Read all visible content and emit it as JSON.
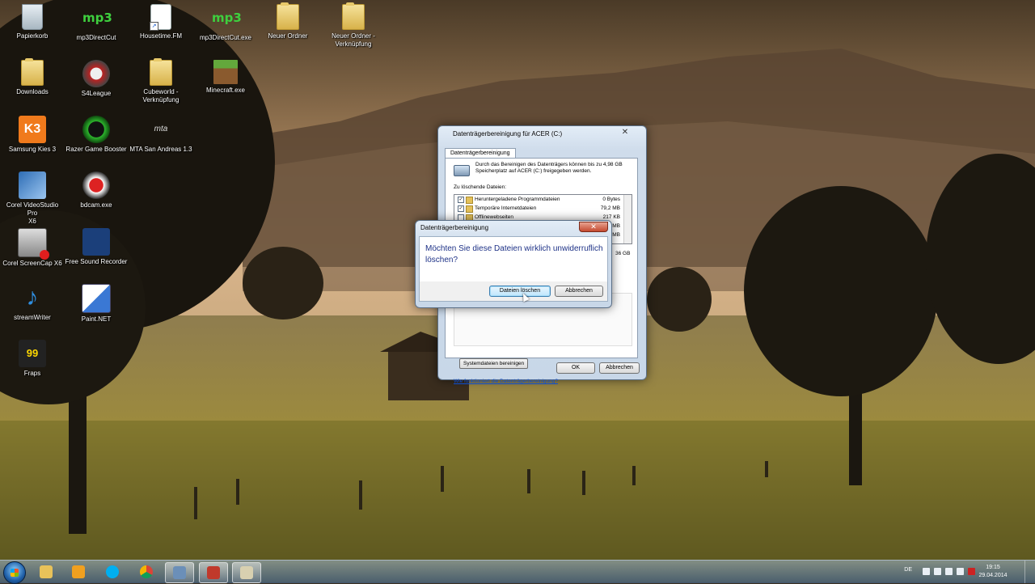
{
  "desktop": {
    "icons": [
      {
        "label": "Papierkorb",
        "icon": "recycle-bin-icon"
      },
      {
        "label": "mp3DirectCut",
        "icon": "mp3-icon",
        "glyph": "mp3"
      },
      {
        "label": "Housetime.FM",
        "icon": "document-icon"
      },
      {
        "label": "mp3DirectCut.exe",
        "icon": "mp3-icon",
        "glyph": "mp3"
      },
      {
        "label": "Neuer Ordner",
        "icon": "folder-icon"
      },
      {
        "label": "Neuer Ordner -",
        "label2": "Verknüpfung",
        "icon": "folder-icon"
      },
      {
        "label": "Downloads",
        "icon": "folder-icon"
      },
      {
        "label": "S4League",
        "icon": "s4league-icon"
      },
      {
        "label": "Cubeworld -",
        "label2": "Verknüpfung",
        "icon": "folder-icon"
      },
      {
        "label": "Minecraft.exe",
        "icon": "minecraft-icon"
      },
      {
        "label": "Samsung Kies 3",
        "icon": "kies-icon",
        "glyph": "K3"
      },
      {
        "label": "Razer Game Booster",
        "icon": "razer-icon"
      },
      {
        "label": "MTA San Andreas 1.3",
        "icon": "mta-icon",
        "glyph": "mta"
      },
      {
        "label": "Corel VideoStudio Pro",
        "label2": "X6",
        "icon": "corel-icon"
      },
      {
        "label": "bdcam.exe",
        "icon": "bandicam-icon"
      },
      {
        "label": "Corel ScreenCap X6",
        "icon": "screencap-icon"
      },
      {
        "label": "Free Sound Recorder",
        "icon": "sound-recorder-icon"
      },
      {
        "label": "streamWriter",
        "icon": "music-note-icon",
        "glyph": "♪"
      },
      {
        "label": "Paint.NET",
        "icon": "paint-icon"
      },
      {
        "label": "Fraps",
        "icon": "fraps-icon",
        "glyph": "99"
      }
    ]
  },
  "cleanup_window": {
    "title": "Datenträgerbereinigung für ACER (C:)",
    "close_glyph": "✕",
    "tab_label": "Datenträgerbereinigung",
    "description": "Durch das Bereinigen des Datenträgers können bis zu 4,98 GB Speicherplatz auf ACER (C:) freigegeben werden.",
    "files_label": "Zu löschende Dateien:",
    "files": [
      {
        "name": "Heruntergeladene Programmdateien",
        "size": "0 Bytes",
        "checked": "✓"
      },
      {
        "name": "Temporäre Internetdateien",
        "size": "79,2 MB",
        "checked": "✓"
      },
      {
        "name": "Offlinewebseiten",
        "size": "217 KB",
        "checked": ""
      },
      {
        "name": "",
        "size": "MB",
        "checked": ""
      },
      {
        "name": "",
        "size": "MB",
        "checked": ""
      }
    ],
    "total_fragment": "36 GB",
    "system_files_button": "Systemdateien bereinigen",
    "help_link": "Wie funktioniert die Datenträgerbereinigung?",
    "ok_button": "OK",
    "cancel_button": "Abbrechen"
  },
  "confirm_dialog": {
    "title": "Datenträgerbereinigung",
    "close_glyph": "✕",
    "message": "Möchten Sie diese Dateien wirklich unwiderruflich löschen?",
    "delete_button": "Dateien löschen",
    "cancel_button": "Abbrechen"
  },
  "taskbar": {
    "apps": [
      {
        "name": "explorer",
        "icon": "folder-icon",
        "color": "#e8c25a"
      },
      {
        "name": "media-player",
        "icon": "media-player-icon",
        "color": "#f0a020"
      },
      {
        "name": "skype",
        "icon": "skype-icon",
        "color": "#00aff0"
      },
      {
        "name": "chrome",
        "icon": "chrome-icon",
        "color": "#db4437"
      },
      {
        "name": "corel-videostudio",
        "icon": "corel-icon",
        "color": "#6b8fb8"
      },
      {
        "name": "corel-screencap",
        "icon": "screencap-icon",
        "color": "#c0392b"
      },
      {
        "name": "disk-cleanup",
        "icon": "disk-cleanup-icon",
        "color": "#d8d0b0"
      }
    ],
    "language": "DE",
    "time": "19:15",
    "date": "29.04.2014"
  }
}
